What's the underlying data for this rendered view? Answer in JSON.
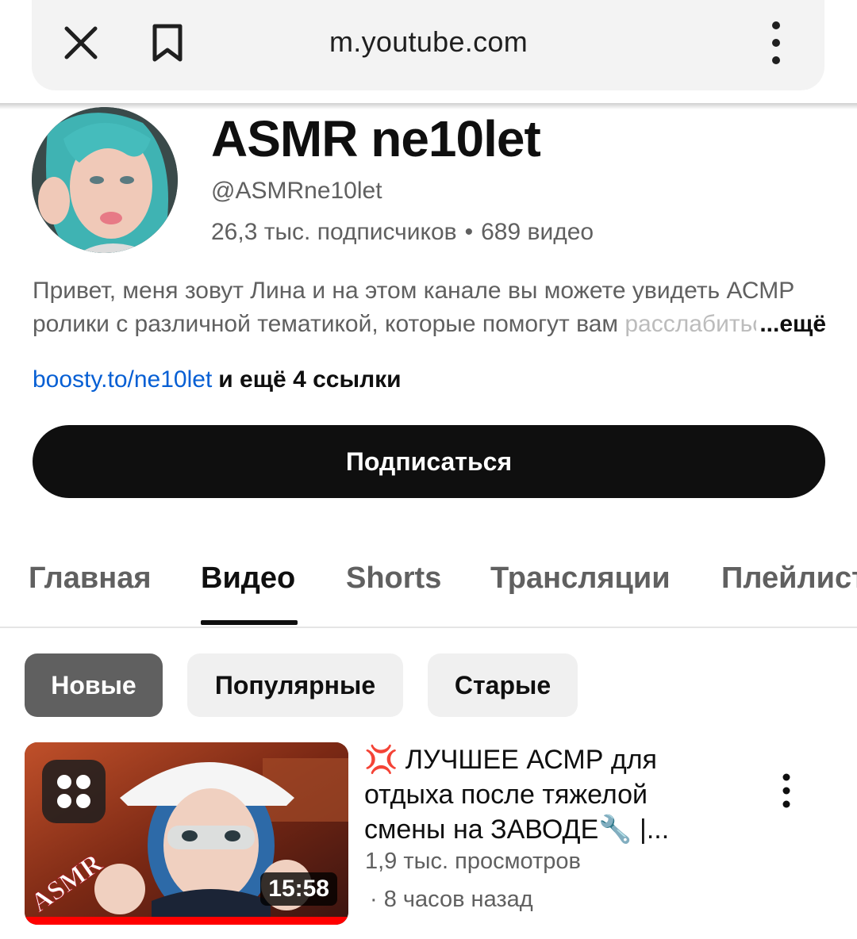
{
  "browser": {
    "url": "m.youtube.com",
    "icons": [
      "close-icon",
      "bookmark-icon",
      "more-vert-icon"
    ]
  },
  "channel": {
    "name": "ASMR ne10let",
    "handle": "@ASMRne10let",
    "subscribers": "26,3 тыс. подписчиков",
    "separator": "•",
    "video_count": "689 видео",
    "description_line1": "Привет, меня зовут Лина и на этом канале вы можете увидеть АСМР",
    "description_line2": "ролики с различной тематикой, которые помогут вам ",
    "description_fade": "расслабиться",
    "description_more": "...ещё",
    "link": "boosty.to/ne10let",
    "more_links": "и ещё 4 ссылки",
    "subscribe_label": "Подписаться"
  },
  "tabs": [
    "Главная",
    "Видео",
    "Shorts",
    "Трансляции",
    "Плейлисты"
  ],
  "active_tab": "Видео",
  "chips": [
    "Новые",
    "Популярные",
    "Старые"
  ],
  "active_chip": "Новые",
  "video": {
    "title_emoji": "💢",
    "title": " ЛУЧШЕЕ АСМР для отдыха после тяжелой смены на ЗАВОДЕ🔧 |...",
    "views": "1,9 тыс. просмотров",
    "age": "· 8 часов назад",
    "duration": "15:58",
    "thumbnail_text": "ASMR",
    "progress_fraction": 1.0
  },
  "colors": {
    "primary_text": "#0f0f0f",
    "secondary_text": "#606060",
    "link": "#065fd4",
    "progress": "#ff0000"
  }
}
